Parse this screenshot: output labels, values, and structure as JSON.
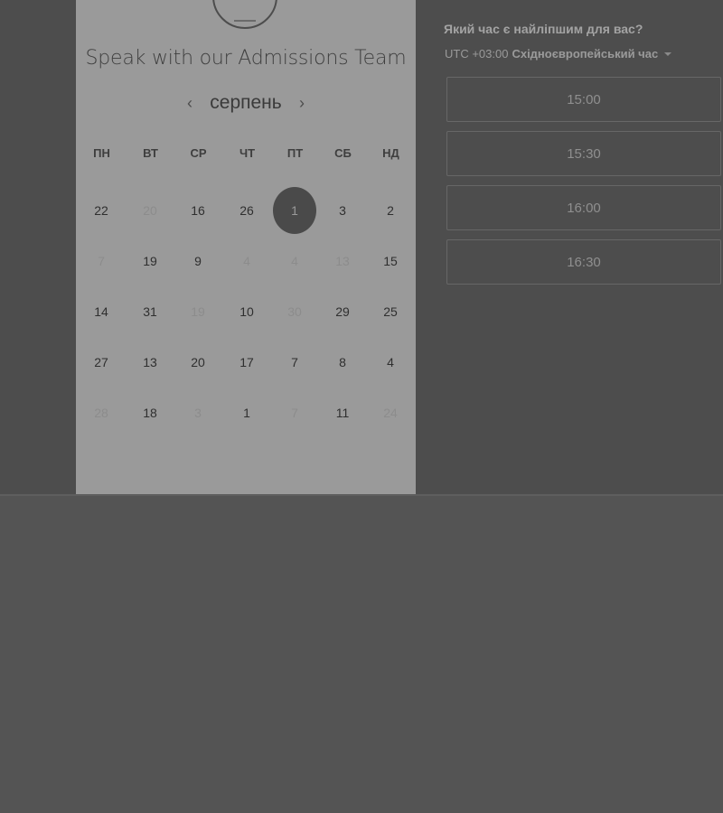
{
  "calendar": {
    "headline": "Speak with our Admissions Team",
    "month": "серпень",
    "weekdays": [
      "ПН",
      "ВТ",
      "СР",
      "ЧТ",
      "ПТ",
      "СБ",
      "НД"
    ],
    "weeks": [
      [
        "22",
        "20",
        "16",
        "26",
        "1",
        "3",
        "2"
      ],
      [
        "7",
        "19",
        "9",
        "4",
        "4",
        "13",
        "15"
      ],
      [
        "14",
        "31",
        "19",
        "10",
        "30",
        "29",
        "25"
      ],
      [
        "27",
        "13",
        "20",
        "17",
        "7",
        "8",
        "4"
      ],
      [
        "28",
        "18",
        "3",
        "1",
        "7",
        "11",
        "24"
      ]
    ],
    "selected_day": "1"
  },
  "times": {
    "title": "Який час є найліпшим для вас?",
    "tz_offset": "UTC +03:00",
    "tz_name": "Східноєвропейський час",
    "slots": [
      "15:00",
      "15:30",
      "16:00",
      "16:30"
    ]
  },
  "icons": {
    "prev": "chevron-left-icon",
    "next": "chevron-right-icon",
    "tz_dropdown": "caret-down-icon"
  }
}
